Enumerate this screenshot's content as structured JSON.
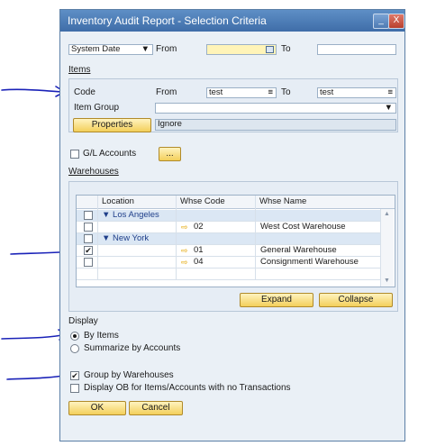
{
  "window": {
    "title": "Inventory Audit Report - Selection Criteria",
    "minimize": "_",
    "close": "X"
  },
  "date_criteria": {
    "type": "System Date",
    "from_label": "From",
    "to_label": "To",
    "from_value": "",
    "to_value": ""
  },
  "items": {
    "section": "Items",
    "code_label": "Code",
    "from_label": "From",
    "from_value": "test",
    "to_label": "To",
    "to_value": "test",
    "group_label": "Item Group",
    "group_value": "",
    "properties_button": "Properties",
    "properties_value": "Ignore"
  },
  "gl": {
    "label": "G/L Accounts",
    "button": "..."
  },
  "warehouses": {
    "section": "Warehouses",
    "columns": [
      "Location",
      "Whse Code",
      "Whse Name"
    ],
    "rows": [
      {
        "type": "group",
        "label": "Los Angeles",
        "checked": false
      },
      {
        "type": "item",
        "code": "02",
        "name": "West Cost Warehouse",
        "checked": false
      },
      {
        "type": "group",
        "label": "New York",
        "checked": false
      },
      {
        "type": "item",
        "code": "01",
        "name": "General Warehouse",
        "checked": true
      },
      {
        "type": "item",
        "code": "04",
        "name": "Consignmentl Warehouse",
        "checked": false
      }
    ],
    "expand_button": "Expand",
    "collapse_button": "Collapse"
  },
  "display": {
    "label": "Display",
    "by_items": "By Items",
    "summarize": "Summarize by Accounts",
    "selected": "by_items"
  },
  "options": {
    "group_by": "Group by Warehouses",
    "group_by_checked": true,
    "display_ob": "Display OB for Items/Accounts with no Transactions",
    "display_ob_checked": false
  },
  "buttons": {
    "ok": "OK",
    "cancel": "Cancel"
  },
  "colors": {
    "accent": "#3f6da8",
    "button": "#f3cf5a",
    "annotation": "#1a22b8"
  }
}
